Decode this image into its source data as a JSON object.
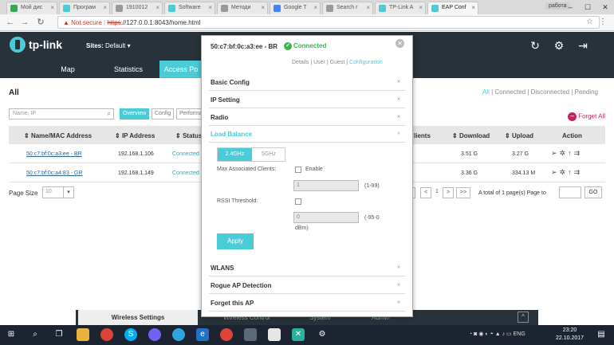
{
  "browser": {
    "tabs": [
      {
        "label": "Мой дис",
        "color": "#34a853"
      },
      {
        "label": "Програм",
        "color": "#4acbd6"
      },
      {
        "label": "1910012",
        "color": "#999999"
      },
      {
        "label": "Software",
        "color": "#4acbd6"
      },
      {
        "label": "Методи",
        "color": "#999999"
      },
      {
        "label": "Google T",
        "color": "#4285f4"
      },
      {
        "label": "Search r",
        "color": "#999999"
      },
      {
        "label": "TP-Link A",
        "color": "#4acbd6"
      },
      {
        "label": "EAP Conf",
        "color": "#4acbd6"
      }
    ],
    "profile": "работа",
    "not_secure": "Not secure",
    "url_scheme": "https",
    "url_rest": "://127.0.0.1:8043/home.html"
  },
  "header": {
    "logo": "tp-link",
    "sites_label": "Sites:",
    "sites_value": "Default ▾"
  },
  "menu": {
    "map": "Map",
    "statistics": "Statistics",
    "access_points": "Access Po"
  },
  "page": {
    "title": "All",
    "filters": {
      "all": "All",
      "sep": " | ",
      "connected": "Connected",
      "disconnected": "Disconnected",
      "pending": "Pending"
    },
    "search_placeholder": "Name, IP",
    "view_tabs": {
      "overview": "Overview",
      "config": "Config",
      "performance": "Performa"
    },
    "forget_all": "Forget All",
    "columns": {
      "name": "Name/MAC Address",
      "ip": "IP Address",
      "status": "Status",
      "clients": "lients",
      "download": "Download",
      "upload": "Upload",
      "action": "Action"
    },
    "rows": [
      {
        "name": "50:c7:bf:0c:a3:ee - BR",
        "ip": "192.168.1.106",
        "status": "Connected",
        "download": "3.51 G",
        "upload": "3.27 G"
      },
      {
        "name": "50:c7:bf:0c:a4:83 - GR",
        "ip": "192.168.1.149",
        "status": "Connected",
        "download": "3.36 G",
        "upload": "334.13 M"
      }
    ],
    "page_size_label": "Page Size",
    "page_size_value": "10",
    "pager": {
      "prev2": "<",
      "prev": "<",
      "page": "1",
      "next": ">",
      "next2": ">>",
      "info": "A total of 1 page(s)   Page to",
      "go": "GO"
    }
  },
  "bottom_bar": {
    "wireless_settings": "Wireless Settings",
    "wireless_control": "Wireless Control",
    "system": "System",
    "admin": "Admin",
    "up": "^"
  },
  "modal": {
    "title": "50:c7:bf:0c:a3:ee - BR",
    "status": "Connected",
    "tabs": {
      "details": "Details",
      "user": "User",
      "guest": "Guest",
      "configuration": "Configuration"
    },
    "sections": {
      "basic": "Basic Config",
      "ip": "IP Setting",
      "radio": "Radio",
      "load_balance": "Load Balance",
      "wlans": "WLANS",
      "rogue": "Rogue AP Detection",
      "forget": "Forget this AP"
    },
    "band_24": "2.4GHz",
    "band_5": "5GHz",
    "max_clients_label": "Max Associated Clients:",
    "enable_label": "Enable",
    "max_clients_value": "1",
    "max_clients_range": "(1-99)",
    "rssi_label": "RSSI Threshold:",
    "rssi_value": "0",
    "rssi_range_1": "(-95-0",
    "rssi_range_2": "dBm)",
    "apply": "Apply"
  },
  "taskbar": {
    "lang": "ENG",
    "time": "23:20",
    "date": "22.10.2017"
  }
}
